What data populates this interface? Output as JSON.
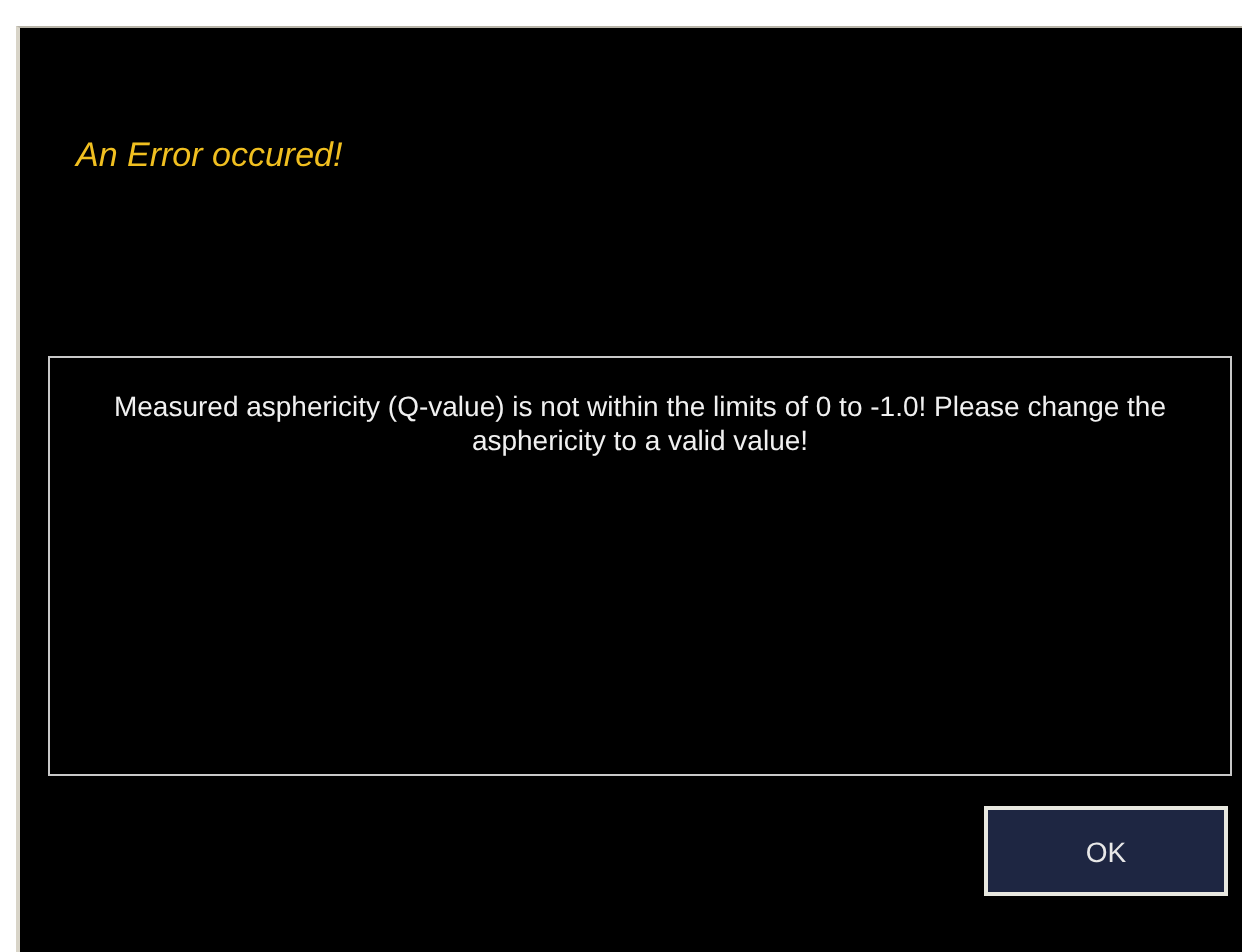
{
  "dialog": {
    "title": "An Error occured!",
    "message": "Measured asphericity (Q-value) is not within the limits of 0 to -1.0! Please change the asphericity to a valid value!",
    "buttons": [
      "OK"
    ]
  }
}
